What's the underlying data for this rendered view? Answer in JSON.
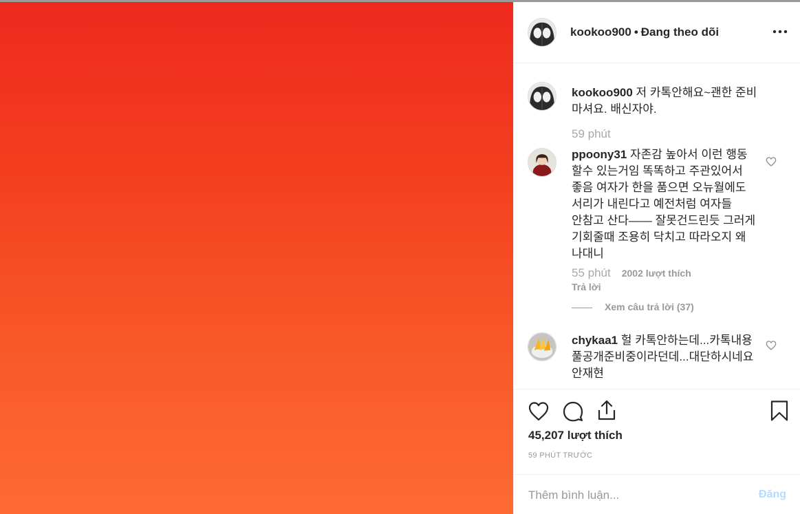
{
  "post": {
    "author": "kookoo900",
    "follow_status": "Đang theo dõi",
    "dot": "•",
    "photo_colors": {
      "top": "#ee2a1e",
      "bottom": "#fd6b33"
    }
  },
  "comments": [
    {
      "user": "kookoo900",
      "text": "저 카톡안해요~괜한 준비 마셔요. 배신자야.",
      "time": "59 phút"
    },
    {
      "user": "ppoony31",
      "text": "자존감 높아서 이런 행동 할수 있는거임 똑똑하고 주관있어서 좋음 여자가 한을 품으면 오뉴월에도 서리가 내린다고 예전처럼 여자들 안참고 산다—— 잘못건드린듯 그러게 기회줄때 조용히 닥치고 따라오지 왜 나대니",
      "time": "55 phút",
      "likes": "2002 lượt thích",
      "reply": "Trả lời",
      "view_replies": "Xem câu trả lời (37)"
    },
    {
      "user": "chykaa1",
      "text": "헐 카톡안하는데...카톡내용 풀공개준비중이라던데...대단하시네요 안재현"
    }
  ],
  "actions": {
    "likes": "45,207 lượt thích",
    "time_ago": "59 PHÚT TRƯỚC",
    "icons": [
      "heart-icon",
      "comment-icon",
      "share-icon",
      "bookmark-icon"
    ]
  },
  "add_comment": {
    "placeholder": "Thêm bình luận...",
    "post_label": "Đăng"
  }
}
